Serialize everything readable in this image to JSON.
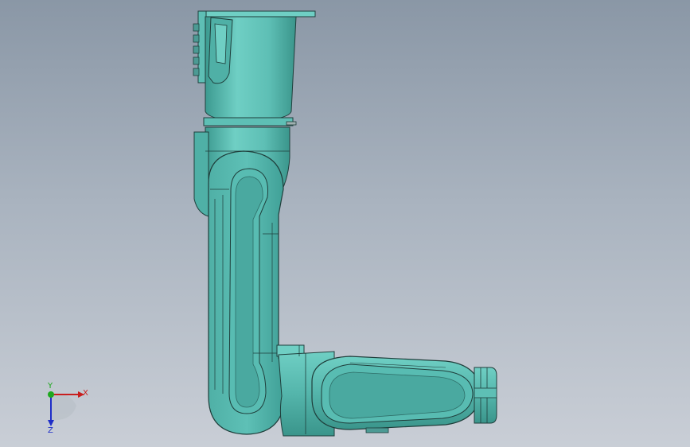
{
  "viewport": {
    "name": "3d-graphics-area",
    "background_top": "#8a97a6",
    "background_bottom": "#c9ced6"
  },
  "model": {
    "name": "robot-arm-assembly",
    "body_color": "#5ebfb5",
    "body_dark": "#3f9f96",
    "body_light": "#7fd6cc",
    "edge_color": "#1f3e3b"
  },
  "triad": {
    "x_label": "X",
    "y_label": "Y",
    "z_label": "Z",
    "x_color": "#c81e1e",
    "y_color": "#1ea81e",
    "z_color": "#1e2ec8"
  }
}
